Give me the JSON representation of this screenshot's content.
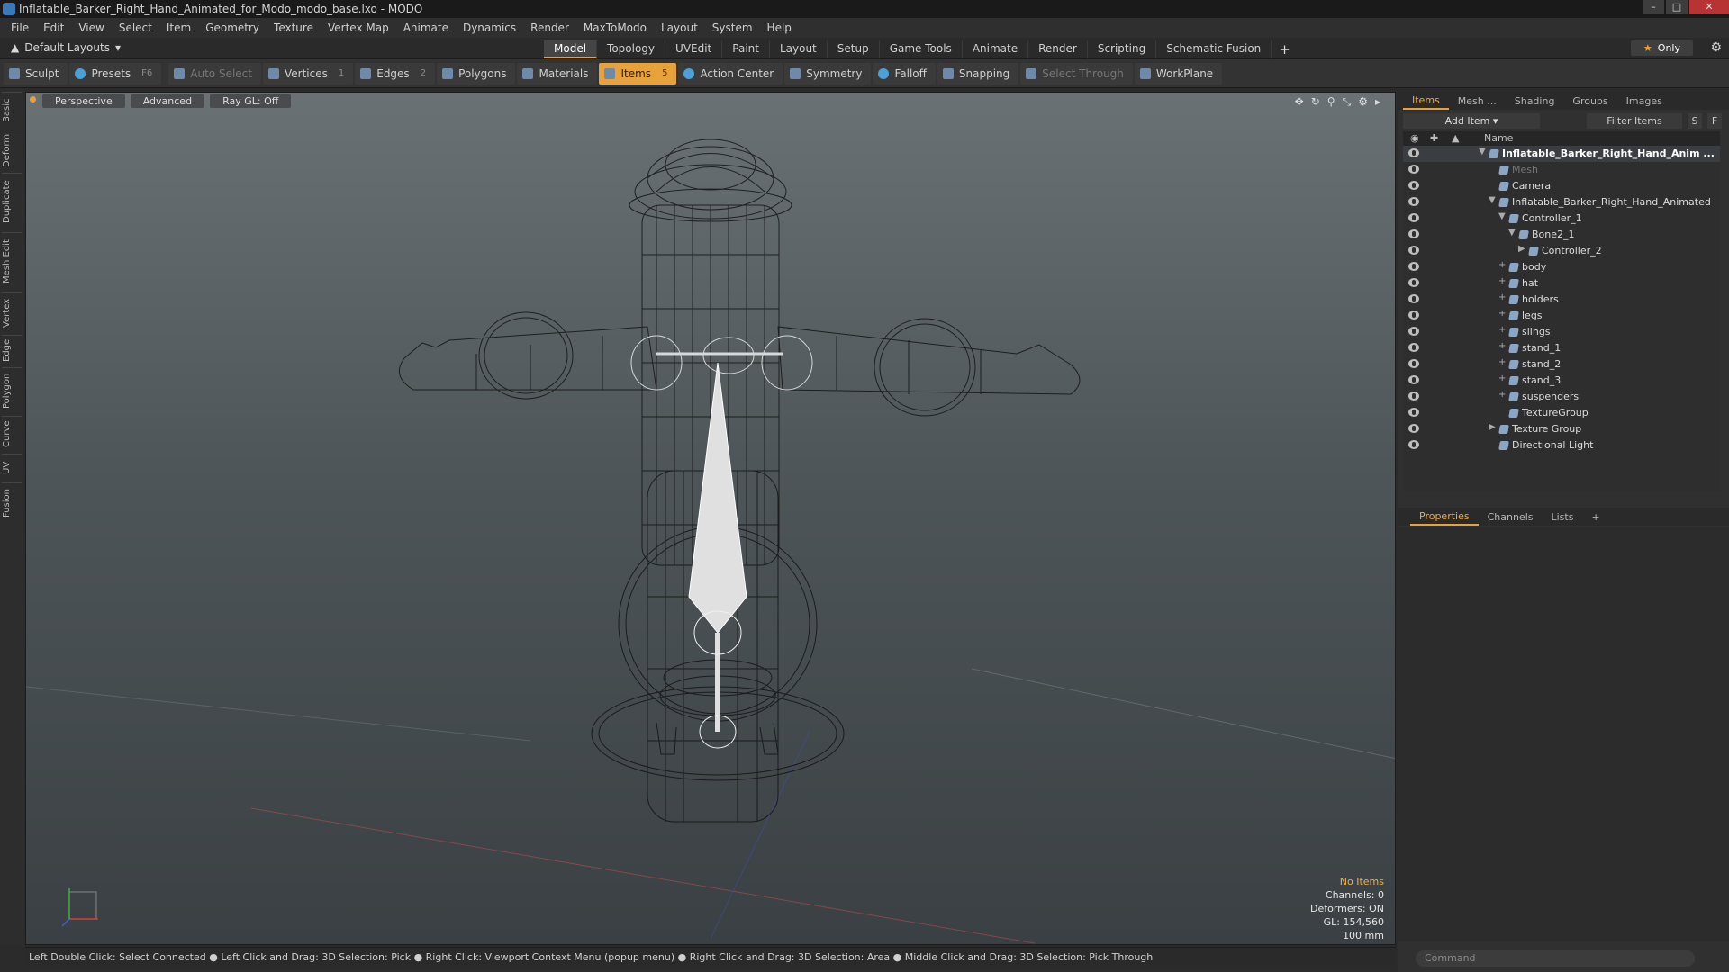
{
  "window": {
    "title": "Inflatable_Barker_Right_Hand_Animated_for_Modo_modo_base.lxo - MODO"
  },
  "menus": [
    "File",
    "Edit",
    "View",
    "Select",
    "Item",
    "Geometry",
    "Texture",
    "Vertex Map",
    "Animate",
    "Dynamics",
    "Render",
    "MaxToModo",
    "Layout",
    "System",
    "Help"
  ],
  "layouts": {
    "label": "Default Layouts"
  },
  "tabs": [
    "Model",
    "Topology",
    "UVEdit",
    "Paint",
    "Layout",
    "Setup",
    "Game Tools",
    "Animate",
    "Render",
    "Scripting",
    "Schematic Fusion"
  ],
  "only_label": "Only",
  "toolbar": {
    "sculpt": "Sculpt",
    "presets": "Presets",
    "presets_hotkey": "F6",
    "auto_select": "Auto Select",
    "vertices": "Vertices",
    "vertices_key": "1",
    "edges": "Edges",
    "edges_key": "2",
    "polygons": "Polygons",
    "materials": "Materials",
    "items": "Items",
    "items_key": "5",
    "action_center": "Action Center",
    "symmetry": "Symmetry",
    "falloff": "Falloff",
    "snapping": "Snapping",
    "select_through": "Select Through",
    "workplane": "WorkPlane"
  },
  "left_tabs": [
    "Basic",
    "Deform",
    "Duplicate",
    "Mesh Edit",
    "Vertex",
    "Edge",
    "Polygon",
    "Curve",
    "UV",
    "Fusion"
  ],
  "viewport": {
    "perspective": "Perspective",
    "advanced": "Advanced",
    "raygl": "Ray GL: Off",
    "info": {
      "no_items": "No Items",
      "channels": "Channels: 0",
      "deformers": "Deformers: ON",
      "gl": "GL: 154,560",
      "scale": "100 mm"
    }
  },
  "status": "Left Double Click: Select Connected ● Left Click and Drag: 3D Selection: Pick ● Right Click: Viewport Context Menu (popup menu) ● Right Click and Drag: 3D Selection: Area ● Middle Click and Drag: 3D Selection: Pick Through",
  "panel": {
    "tabs": [
      "Items",
      "Mesh ...",
      "Shading",
      "Groups",
      "Images"
    ],
    "add_item": "Add Item",
    "filter_items": "Filter Items",
    "s": "S",
    "f": "F",
    "name_col": "Name",
    "tree": [
      {
        "label": "Inflatable_Barker_Right_Hand_Anim ...",
        "indent": 0,
        "toggle": "▼",
        "bold": true
      },
      {
        "label": "Mesh",
        "indent": 1,
        "toggle": "",
        "dim": true
      },
      {
        "label": "Camera",
        "indent": 1,
        "toggle": ""
      },
      {
        "label": "Inflatable_Barker_Right_Hand_Animated",
        "indent": 1,
        "toggle": "▼"
      },
      {
        "label": "Controller_1",
        "indent": 2,
        "toggle": "▼"
      },
      {
        "label": "Bone2_1",
        "indent": 3,
        "toggle": "▼"
      },
      {
        "label": "Controller_2",
        "indent": 4,
        "toggle": "▶"
      },
      {
        "label": "body",
        "indent": 2,
        "toggle": "+"
      },
      {
        "label": "hat",
        "indent": 2,
        "toggle": "+"
      },
      {
        "label": "holders",
        "indent": 2,
        "toggle": "+"
      },
      {
        "label": "legs",
        "indent": 2,
        "toggle": "+"
      },
      {
        "label": "slings",
        "indent": 2,
        "toggle": "+"
      },
      {
        "label": "stand_1",
        "indent": 2,
        "toggle": "+"
      },
      {
        "label": "stand_2",
        "indent": 2,
        "toggle": "+"
      },
      {
        "label": "stand_3",
        "indent": 2,
        "toggle": "+"
      },
      {
        "label": "suspenders",
        "indent": 2,
        "toggle": "+"
      },
      {
        "label": "TextureGroup",
        "indent": 2,
        "toggle": ""
      },
      {
        "label": "Texture Group",
        "indent": 1,
        "toggle": "▶"
      },
      {
        "label": "Directional Light",
        "indent": 1,
        "toggle": ""
      }
    ],
    "prop_tabs": [
      "Properties",
      "Channels",
      "Lists"
    ],
    "command_placeholder": "Command"
  },
  "colors": {
    "accent": "#e8a23c",
    "viewport_top": "#6a7174",
    "viewport_bottom": "#3a4043"
  }
}
